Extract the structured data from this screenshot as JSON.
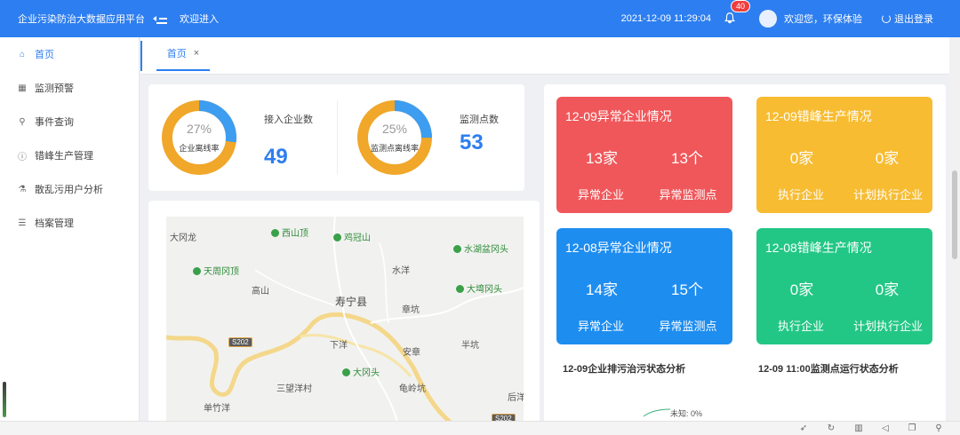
{
  "header": {
    "brand": "企业污染防治大数据应用平台",
    "welcome": "欢迎进入",
    "datetime": "2021-12-09 11:29:04",
    "notifications": "40",
    "greeting": "欢迎您，环保体验",
    "logout": "退出登录",
    "bg_color": "#2d7ef0"
  },
  "sidebar": {
    "items": [
      {
        "label": "首页",
        "icon": "home-icon"
      },
      {
        "label": "监测预警",
        "icon": "calendar-icon"
      },
      {
        "label": "事件查询",
        "icon": "search-icon"
      },
      {
        "label": "错峰生产管理",
        "icon": "info-icon"
      },
      {
        "label": "散乱污用户分析",
        "icon": "flask-icon"
      },
      {
        "label": "档案管理",
        "icon": "list-indent-icon"
      }
    ]
  },
  "tabs": [
    {
      "label": "首页",
      "close": "×"
    }
  ],
  "stats": {
    "enterprise": {
      "pct": "27%",
      "ring_label": "企业离线率",
      "ratio": 0.27,
      "label": "接入企业数",
      "value": "49"
    },
    "points": {
      "pct": "25%",
      "ring_label": "监测点离线率",
      "ratio": 0.25,
      "label": "监测点数",
      "value": "53"
    },
    "ring_colors": {
      "main": "#f0a72a",
      "offline": "#3d9df0"
    }
  },
  "map": {
    "places": [
      {
        "name": "大冈龙",
        "type": "town"
      },
      {
        "name": "西山顶",
        "type": "poi"
      },
      {
        "name": "鸡冠山",
        "type": "poi"
      },
      {
        "name": "水湖盆冈头",
        "type": "poi"
      },
      {
        "name": "天周冈顶",
        "type": "poi"
      },
      {
        "name": "水洋",
        "type": "town"
      },
      {
        "name": "高山",
        "type": "town"
      },
      {
        "name": "大塆冈头",
        "type": "poi"
      },
      {
        "name": "寿宁县",
        "type": "county"
      },
      {
        "name": "章坑",
        "type": "town"
      },
      {
        "name": "S202",
        "type": "road"
      },
      {
        "name": "下洋",
        "type": "town"
      },
      {
        "name": "半坑",
        "type": "town"
      },
      {
        "name": "安章",
        "type": "town"
      },
      {
        "name": "大冈头",
        "type": "poi"
      },
      {
        "name": "三望洋村",
        "type": "town"
      },
      {
        "name": "龟岭坑",
        "type": "town"
      },
      {
        "name": "后洋",
        "type": "town"
      },
      {
        "name": "单竹洋",
        "type": "town"
      },
      {
        "name": "S202",
        "type": "road"
      }
    ]
  },
  "status_cards": [
    {
      "title": "12-09异常企业情况",
      "v1": "13家",
      "v2": "13个",
      "l1": "异常企业",
      "l2": "异常监测点",
      "color": "#f0575a"
    },
    {
      "title": "12-09错峰生产情况",
      "v1": "0家",
      "v2": "0家",
      "l1": "执行企业",
      "l2": "计划执行企业",
      "color": "#f7bc32"
    },
    {
      "title": "12-08异常企业情况",
      "v1": "14家",
      "v2": "15个",
      "l1": "异常企业",
      "l2": "异常监测点",
      "color": "#1e8df0"
    },
    {
      "title": "12-08错峰生产情况",
      "v1": "0家",
      "v2": "0家",
      "l1": "执行企业",
      "l2": "计划执行企业",
      "color": "#22c785"
    }
  ],
  "analysis": {
    "left_title": "12-09企业排污治污状态分析",
    "right_title": "12-09 11:00监测点运行状态分析",
    "unknown_label": "未知: 0%"
  }
}
